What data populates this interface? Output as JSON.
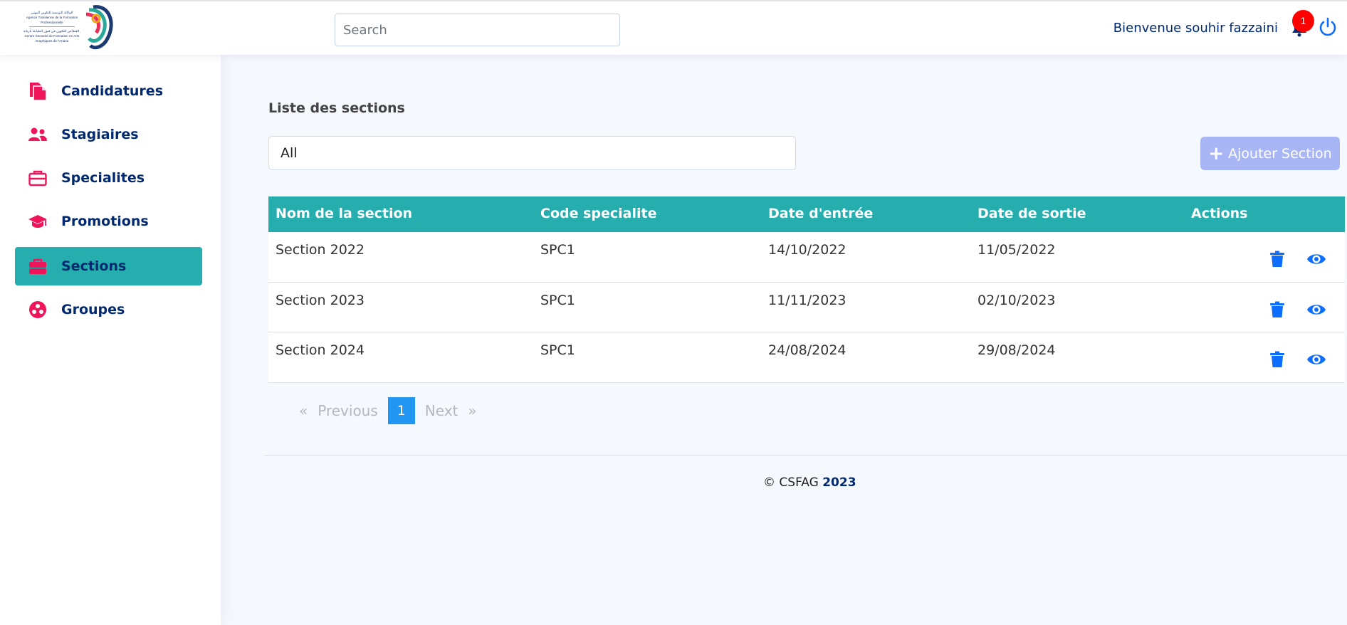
{
  "header": {
    "logo_text_lines": [
      "الوكالة التونسية للتكوين المهني",
      "Agence Tunisienne de la Formation",
      "Professionnelle",
      "المركز القطاعي للتكوين في فنون الطباعة بأريانة",
      "Centre Sectoriel de Formation en Arts",
      "Graphiques de l'Ariana"
    ],
    "search_placeholder": "Search",
    "welcome": "Bienvenue souhir fazzaini",
    "notification_count": "1"
  },
  "sidebar": {
    "items": [
      {
        "label": "Candidatures",
        "icon": "files-icon",
        "active": false
      },
      {
        "label": "Stagiaires",
        "icon": "people-icon",
        "active": false
      },
      {
        "label": "Specialites",
        "icon": "briefcase-icon",
        "active": false
      },
      {
        "label": "Promotions",
        "icon": "graduation-cap-icon",
        "active": false
      },
      {
        "label": "Sections",
        "icon": "toolbox-icon",
        "active": true
      },
      {
        "label": "Groupes",
        "icon": "group-circle-icon",
        "active": false
      }
    ]
  },
  "main": {
    "title": "Liste des sections",
    "filter_value": "All",
    "add_button": "Ajouter Section",
    "table": {
      "columns": [
        "Nom de la section",
        "Code specialite",
        "Date d'entrée",
        "Date de sortie",
        "Actions"
      ],
      "rows": [
        [
          "Section 2022",
          "SPC1",
          "14/10/2022",
          "11/05/2022"
        ],
        [
          "Section 2023",
          "SPC1",
          "11/11/2023",
          "02/10/2023"
        ],
        [
          "Section 2024",
          "SPC1",
          "24/08/2024",
          "29/08/2024"
        ]
      ]
    },
    "pagination": {
      "first": "«",
      "previous": "Previous",
      "current": "1",
      "next": "Next",
      "last": "»"
    }
  },
  "footer": {
    "copyright": "© CSFAG",
    "year": "2023"
  },
  "colors": {
    "accent": "#26adad",
    "brand_navy": "#012970",
    "icon_pink": "#f0145a",
    "action_blue": "#0d6efd",
    "add_button": "#a9b6f5",
    "badge_red": "#ff0000"
  }
}
